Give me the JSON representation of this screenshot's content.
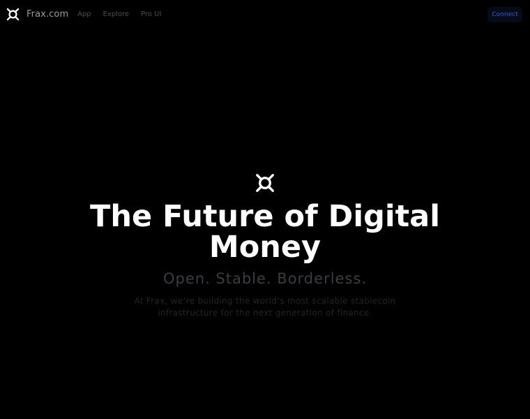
{
  "header": {
    "brand_name": "Frax.com",
    "brand_icon": "frax-logo-icon",
    "nav": [
      {
        "label": "App"
      },
      {
        "label": "Explore"
      },
      {
        "label": "Pro UI"
      }
    ],
    "connect_label": "Connect"
  },
  "hero": {
    "icon": "frax-logo-icon",
    "title": "The Future of Digital Money",
    "tagline": "Open. Stable. Borderless.",
    "description": "At Frax, we’re building the world’s most scalable stablecoin infrastructure for the next generation of finance."
  },
  "colors": {
    "background": "#000000",
    "title": "#ffffff",
    "nav_text": "#4c4c52",
    "brand_text": "#9a9aa2",
    "connect_text": "#3258cc",
    "connect_bg": "#070b18"
  }
}
